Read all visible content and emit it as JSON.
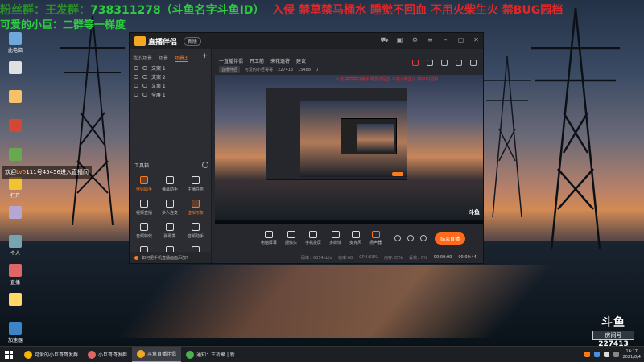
{
  "overlay": {
    "line1_prefix": "粉丝群：王发群：",
    "line1_number": "738311278",
    "line1_id": "（斗鱼名字斗鱼ID）",
    "line1_warn": "入侵 禁草禁马桶水 睡觉不回血 不用火柴生火 禁BUG园档",
    "line2": "可爱的小巨：二群等一梯度"
  },
  "desktop_icons": [
    {
      "label": "此电脑",
      "color": "#6fa8dc"
    },
    {
      "label": "",
      "color": "#e0e0e0"
    },
    {
      "label": "",
      "color": "#f5c26b"
    },
    {
      "label": "",
      "color": "#d14836"
    },
    {
      "label": "",
      "color": "#6aa84f"
    },
    {
      "label": "打开",
      "color": "#f1c232"
    },
    {
      "label": "",
      "color": "#b4a7d6"
    },
    {
      "label": "个人",
      "color": "#76a5af"
    },
    {
      "label": "直播",
      "color": "#e06666"
    },
    {
      "label": "",
      "color": "#ffd966"
    },
    {
      "label": "加速器",
      "color": "#3d85c6"
    }
  ],
  "notice": {
    "prefix": "欢迎",
    "highlight": "LV5",
    "text": "111号45456进入直播间"
  },
  "app": {
    "name": "直播伴侣",
    "version": "新版",
    "scene_tabs": [
      "我的场景",
      "场景",
      "场景3"
    ],
    "sources": [
      "文案 1",
      "文案 2",
      "文案 1",
      "全屏 1"
    ],
    "tools_title": "工具箱",
    "tools": [
      {
        "label": "伴侣助手",
        "orange": true
      },
      {
        "label": "弹幕助手",
        "orange": false
      },
      {
        "label": "主播任务",
        "orange": false
      },
      {
        "label": "视频直播",
        "orange": false
      },
      {
        "label": "多人连麦",
        "orange": false
      },
      {
        "label": "虚拟形象",
        "orange": true
      },
      {
        "label": "音频特效",
        "orange": false
      },
      {
        "label": "弹幕秀",
        "orange": false
      },
      {
        "label": "音频助手",
        "orange": false
      },
      {
        "label": "",
        "orange": false
      },
      {
        "label": "",
        "orange": false
      },
      {
        "label": "",
        "orange": false
      }
    ],
    "hint": "如何把手机直播画面添加？",
    "room_links": [
      "一直播伴侣",
      "开工前",
      "来花选将",
      "建议"
    ],
    "room_info": {
      "tag": "直播伴侣",
      "title": "可爱的小巨哥哥",
      "hot": "227413",
      "fans": "15488",
      "extra": "0"
    },
    "preview_warn": "入侵 禁草禁马桶水 睡觉不回血 不用火柴生火 禁BUG园档",
    "preview_douyu": "斗鱼",
    "live_tools": [
      {
        "label": "电脑屏幕",
        "orange": false
      },
      {
        "label": "摄像头",
        "orange": false
      },
      {
        "label": "手机投屏",
        "orange": false
      },
      {
        "label": "多媒体",
        "orange": false
      },
      {
        "label": "麦克风",
        "orange": false
      },
      {
        "label": "扬声器",
        "orange": true
      }
    ],
    "start_label": "结束直播",
    "status": {
      "bitrate": "码率：6054kb/s",
      "fps": "帧率:60",
      "cpu": "CPU:33%",
      "mem": "内存:85%",
      "lost": "丢帧：0%",
      "live_time": "00:00:00",
      "rec_time": "00:00:44"
    }
  },
  "douyu": {
    "logo": "斗鱼",
    "room_label": "房间号",
    "room_number": "227413"
  },
  "taskbar": {
    "items": [
      {
        "label": "可爱的小巨哥哥发群",
        "color": "#f4b400",
        "active": false
      },
      {
        "label": "小巨哥哥发群",
        "color": "#e06666",
        "active": false
      },
      {
        "label": "斗鱼直播伴侣",
        "color": "#f5a623",
        "active": true
      },
      {
        "label": "通知：王祈聚 | 新...",
        "color": "#4caf50",
        "active": false
      }
    ],
    "time": "16:17",
    "date": "2021/8/4"
  }
}
